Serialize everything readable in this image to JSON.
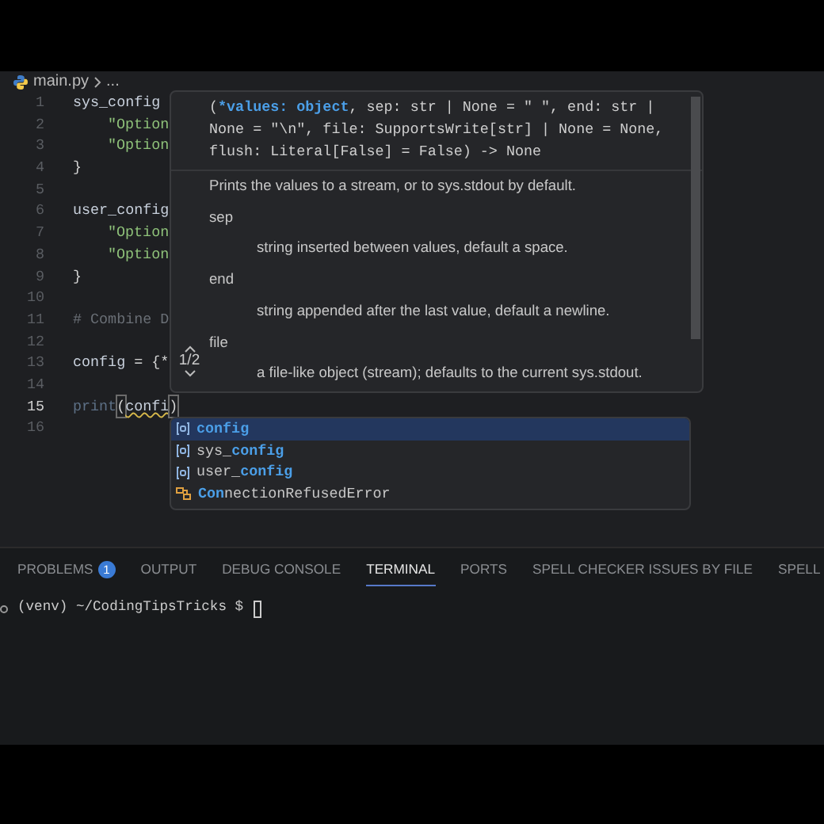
{
  "breadcrumb": {
    "file": "main.py",
    "rest": "..."
  },
  "editor": {
    "lines": [
      {
        "number": "1",
        "current": false,
        "indented": false,
        "tokens": [
          {
            "text": "sys_config",
            "kind": "variable"
          }
        ]
      },
      {
        "number": "2",
        "current": false,
        "indented": true,
        "tokens": [
          {
            "text": "\"Option",
            "kind": "string"
          }
        ]
      },
      {
        "number": "3",
        "current": false,
        "indented": true,
        "tokens": [
          {
            "text": "\"Option",
            "kind": "string"
          }
        ]
      },
      {
        "number": "4",
        "current": false,
        "indented": false,
        "tokens": [
          {
            "text": "}",
            "kind": "plain"
          }
        ]
      },
      {
        "number": "5",
        "current": false
      },
      {
        "number": "6",
        "current": false,
        "indented": false,
        "tokens": [
          {
            "text": "user_config",
            "kind": "variable"
          }
        ]
      },
      {
        "number": "7",
        "current": false,
        "indented": true,
        "tokens": [
          {
            "text": "\"Option",
            "kind": "string"
          }
        ]
      },
      {
        "number": "8",
        "current": false,
        "indented": true,
        "tokens": [
          {
            "text": "\"Option",
            "kind": "string"
          }
        ]
      },
      {
        "number": "9",
        "current": false,
        "indented": false,
        "tokens": [
          {
            "text": "}",
            "kind": "plain"
          }
        ]
      },
      {
        "number": "10",
        "current": false
      },
      {
        "number": "11",
        "current": false,
        "indented": false,
        "tokens": [
          {
            "text": "# Combine D",
            "kind": "comment"
          }
        ]
      },
      {
        "number": "12",
        "current": false
      },
      {
        "number": "13",
        "current": false,
        "indented": false,
        "tokens": [
          {
            "text": "config",
            "kind": "variable"
          },
          {
            "text": " = {*",
            "kind": "plain"
          }
        ]
      },
      {
        "number": "14",
        "current": false
      },
      {
        "number": "15",
        "current": true,
        "indented": false,
        "tokens": [
          {
            "text": "print",
            "kind": "function"
          },
          {
            "text": "(",
            "kind": "bracket"
          },
          {
            "text": "confi",
            "kind": "squiggly"
          },
          {
            "text": ")",
            "kind": "bracket"
          }
        ]
      },
      {
        "number": "16",
        "current": false
      }
    ]
  },
  "hover": {
    "signature": [
      [
        {
          "text": "(",
          "active": false
        },
        {
          "text": "*values: object",
          "active": true
        },
        {
          "text": ", sep: str | None = \" \", end: str |",
          "active": false
        }
      ],
      [
        {
          "text": "None = \"\\n\", file: SupportsWrite[str] | None = None,",
          "active": false
        }
      ],
      [
        {
          "text": "flush: Literal[False] = False) -> None",
          "active": false
        }
      ]
    ],
    "summary": "Prints the values to a stream, or to sys.stdout by default.",
    "params": [
      {
        "name": "sep",
        "description": "string inserted between values, default a space."
      },
      {
        "name": "end",
        "description": "string appended after the last value, default a newline."
      },
      {
        "name": "file",
        "description": "a file-like object (stream); defaults to the current sys.stdout."
      }
    ],
    "overload": "1/2"
  },
  "suggestions": [
    {
      "kind": "variable",
      "selected": true,
      "parts": [
        {
          "text": "config",
          "match": true
        }
      ]
    },
    {
      "kind": "variable",
      "selected": false,
      "parts": [
        {
          "text": "sys_",
          "match": false
        },
        {
          "text": "config",
          "match": true
        }
      ]
    },
    {
      "kind": "variable",
      "selected": false,
      "parts": [
        {
          "text": "user_",
          "match": false
        },
        {
          "text": "config",
          "match": true
        }
      ]
    },
    {
      "kind": "class",
      "selected": false,
      "parts": [
        {
          "text": "Con",
          "match": true
        },
        {
          "text": "nectionRefusedError",
          "match": false
        }
      ]
    }
  ],
  "panel": {
    "tabs": [
      {
        "label": "PROBLEMS",
        "badge": "1",
        "selected": false
      },
      {
        "label": "OUTPUT",
        "selected": false
      },
      {
        "label": "DEBUG CONSOLE",
        "selected": false
      },
      {
        "label": "TERMINAL",
        "selected": true
      },
      {
        "label": "PORTS",
        "selected": false
      },
      {
        "label": "SPELL CHECKER ISSUES BY FILE",
        "selected": false
      },
      {
        "label": "SPELL",
        "selected": false
      }
    ],
    "terminal": {
      "prompt": "(venv) ~/CodingTipsTricks $"
    }
  }
}
